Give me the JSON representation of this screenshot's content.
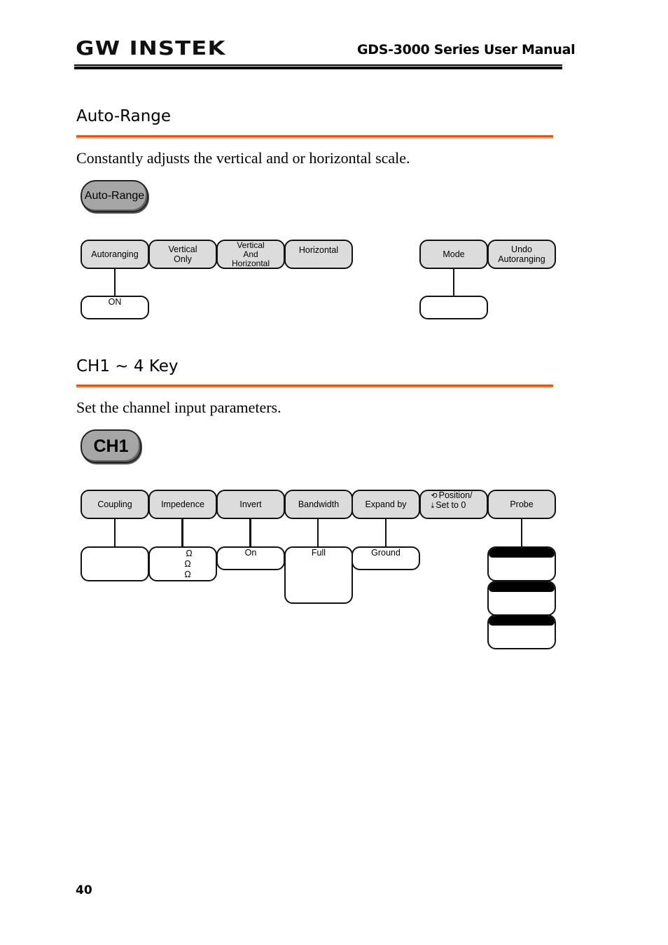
{
  "header": {
    "logo": "GW INSTEK",
    "manual_title": "GDS-3000 Series User Manual"
  },
  "auto_range": {
    "title": "Auto-Range",
    "description": "Constantly adjusts the vertical and or horizontal scale.",
    "key_label": "Auto-Range",
    "menu_left": [
      "Autoranging",
      "Vertical\nOnly",
      "Vertical\nAnd\nHorizontal",
      "Horizontal"
    ],
    "menu_right": [
      "Mode",
      "Undo\nAutoranging"
    ],
    "autoranging_sub": "ON",
    "mode_sub": ""
  },
  "ch_key": {
    "title": "CH1 ~ 4 Key",
    "description": "Set the channel input parameters.",
    "key_label": "CH1",
    "menu": [
      "Coupling",
      "Impedence",
      "Invert",
      "Bandwidth",
      "Expand by",
      "Position/\nSet to 0",
      "Probe"
    ],
    "position_icons": [
      "rotate-knob-icon",
      "push-set-zero-icon"
    ],
    "coupling_sub": "",
    "impedence_sub": [
      "Ω",
      "Ω",
      "Ω"
    ],
    "invert_sub": "On",
    "bandwidth_sub": "Full",
    "expand_sub": "Ground",
    "probe_sub_count": 3
  },
  "footer": {
    "page_number": "40"
  }
}
